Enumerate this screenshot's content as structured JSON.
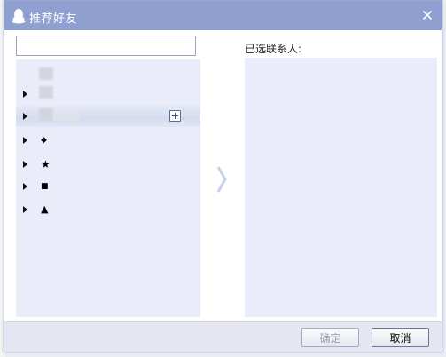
{
  "dialog": {
    "title": "推荐好友"
  },
  "search": {
    "value": "",
    "placeholder": ""
  },
  "tree": {
    "groups": [
      {
        "glyph": ""
      },
      {
        "glyph": ""
      },
      {
        "glyph": "◆"
      },
      {
        "glyph": "★"
      },
      {
        "glyph": "■"
      },
      {
        "glyph": "▲"
      }
    ]
  },
  "selected": {
    "label": "已选联系人:"
  },
  "buttons": {
    "ok": "确定",
    "cancel": "取消"
  },
  "colors": {
    "titlebar": "#8f9fd0",
    "panel": "#eaedf9",
    "footer": "#e4e7f1"
  }
}
